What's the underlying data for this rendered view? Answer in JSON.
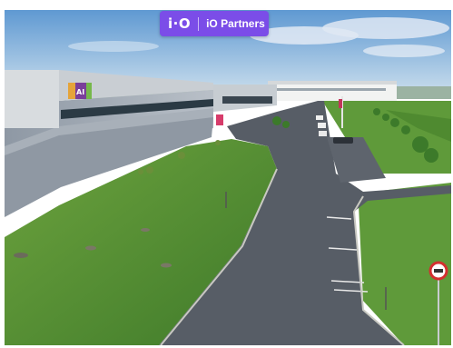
{
  "badge": {
    "logo": "i·O",
    "text": "iO Partners",
    "color": "#7b4de8"
  },
  "building_sign": {
    "text": "AI"
  },
  "colors": {
    "sky": "#7fb0dd",
    "grass": "#5f9a3a",
    "asphalt": "#565c66"
  }
}
